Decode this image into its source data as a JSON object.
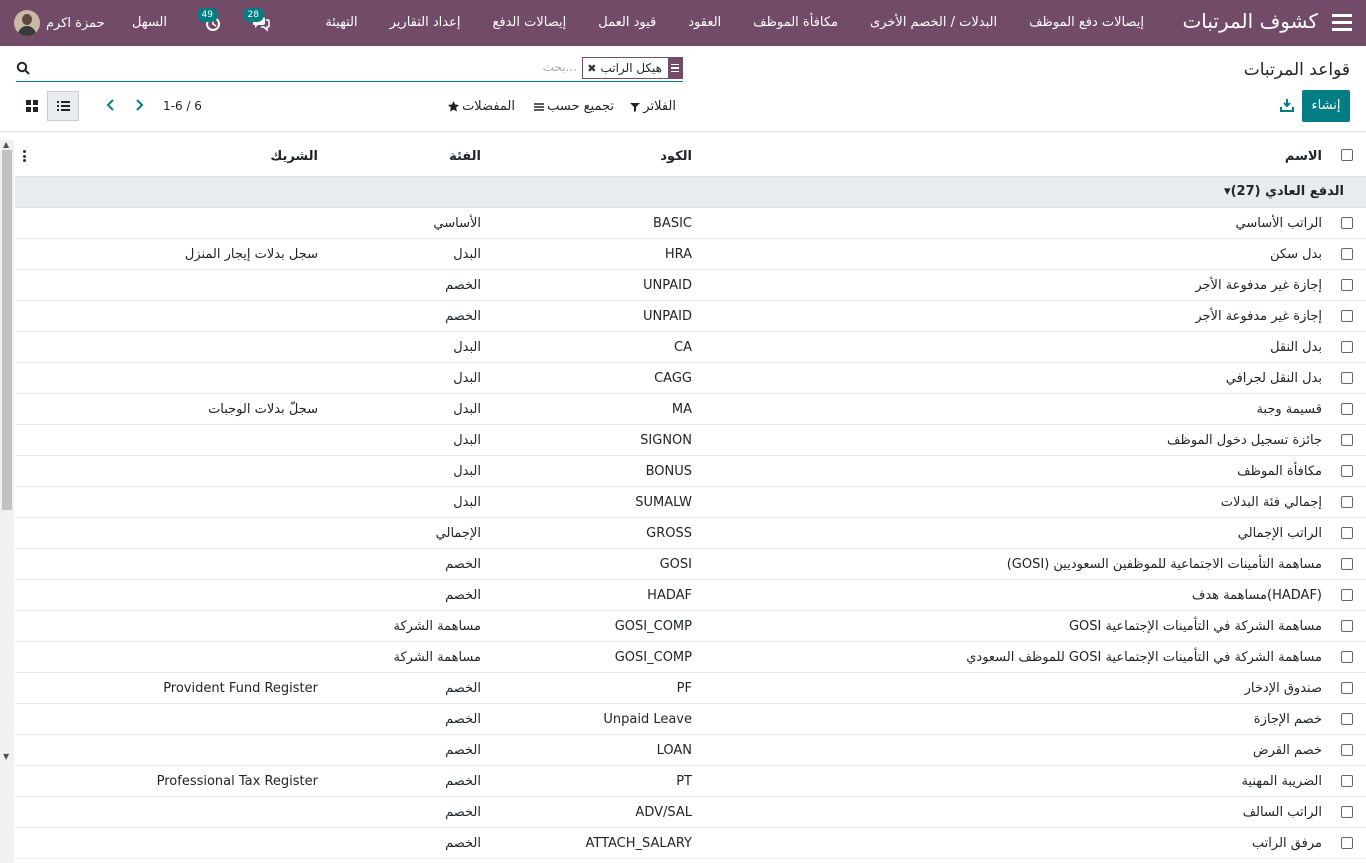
{
  "navbar": {
    "brand": "كشوف المرتبات",
    "items": [
      "إيصالات دفع الموظف",
      "البدلات / الخصم الأخرى",
      "مكافأة الموظف",
      "العقود",
      "قيود العمل",
      "إيصالات الدفع",
      "إعداد التقارير",
      "التهيئة"
    ],
    "messages_count": "28",
    "activities_count": "49",
    "company": "السهل",
    "user_name": "حمزة اكرم"
  },
  "control_panel": {
    "title": "قواعد المرتبات",
    "create_label": "إنشاء",
    "search_placeholder": "بحث...",
    "facet_label": "هيكل الراتب",
    "filters_label": "الفلاتر",
    "group_by_label": "تجميع حسب",
    "favorites_label": "المفضلات",
    "pager": "1-6 / 6"
  },
  "table": {
    "headers": {
      "name": "الاسم",
      "code": "الكود",
      "category": "الفئة",
      "partner": "الشريك"
    },
    "group": "الدفع العادي (27)",
    "rows": [
      {
        "name": "الراتب الأساسي",
        "code": "BASIC",
        "category": "الأساسي",
        "partner": ""
      },
      {
        "name": "بدل سكن",
        "code": "HRA",
        "category": "البدل",
        "partner": "سجل بدلات إيجار المنزل"
      },
      {
        "name": "إجازة غير مدفوعة الأجر",
        "code": "UNPAID",
        "category": "الخصم",
        "partner": ""
      },
      {
        "name": "إجازة غير مدفوعة الأجر",
        "code": "UNPAID",
        "category": "الخصم",
        "partner": ""
      },
      {
        "name": "بدل النقل",
        "code": "CA",
        "category": "البدل",
        "partner": ""
      },
      {
        "name": "بدل النقل لجرافي",
        "code": "CAGG",
        "category": "البدل",
        "partner": ""
      },
      {
        "name": "قسيمة وجبة",
        "code": "MA",
        "category": "البدل",
        "partner": "سجلّ بدلات الوجبات"
      },
      {
        "name": "جائزة تسجيل دخول الموظف",
        "code": "SIGNON",
        "category": "البدل",
        "partner": ""
      },
      {
        "name": "مكافأة الموظف",
        "code": "BONUS",
        "category": "البدل",
        "partner": ""
      },
      {
        "name": "إجمالي فئة البدلات",
        "code": "SUMALW",
        "category": "البدل",
        "partner": ""
      },
      {
        "name": "الراتب الإجمالي",
        "code": "GROSS",
        "category": "الإجمالي",
        "partner": ""
      },
      {
        "name": "(GOSI) مساهمة التأمينات الاجتماعية للموظفين السعوديين",
        "code": "GOSI",
        "category": "الخصم",
        "partner": ""
      },
      {
        "name": "مساهمة هدف(HADAF)",
        "code": "HADAF",
        "category": "الخصم",
        "partner": ""
      },
      {
        "name": "GOSI مساهمة الشركة في التأمينات الإجتماعية",
        "code": "GOSI_COMP",
        "category": "مساهمة الشركة",
        "partner": ""
      },
      {
        "name": "للموظف السعودي GOSI مساهمة الشركة في التأمينات الإجتماعية",
        "code": "GOSI_COMP",
        "category": "مساهمة الشركة",
        "partner": ""
      },
      {
        "name": "صندوق الإدخار",
        "code": "PF",
        "category": "الخصم",
        "partner": "Provident Fund Register"
      },
      {
        "name": "خصم الإجازة",
        "code": "Unpaid Leave",
        "category": "الخصم",
        "partner": ""
      },
      {
        "name": "خصم القرض",
        "code": "LOAN",
        "category": "الخصم",
        "partner": ""
      },
      {
        "name": "الضريبة المهنية",
        "code": "PT",
        "category": "الخصم",
        "partner": "Professional Tax Register"
      },
      {
        "name": "الراتب السالف",
        "code": "ADV/SAL",
        "category": "الخصم",
        "partner": ""
      },
      {
        "name": "مرفق الراتب",
        "code": "ATTACH_SALARY",
        "category": "الخصم",
        "partner": ""
      }
    ]
  }
}
